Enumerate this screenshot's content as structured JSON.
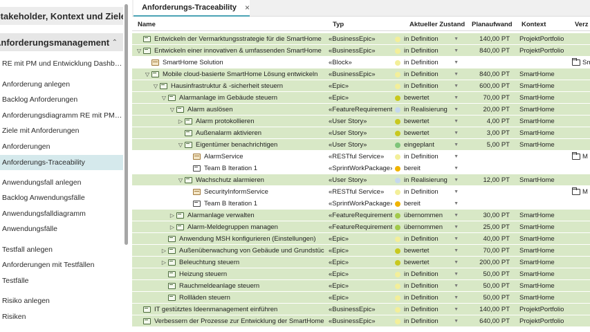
{
  "sidebar": {
    "sections": [
      {
        "label": "Stakeholder, Kontext und Ziele",
        "chevron": "chevron-down-icon"
      },
      {
        "label": "Anforderungsmanagement",
        "chevron": "chevron-up-icon"
      }
    ],
    "items": [
      "RE mit PM und Entwicklung Dashboard",
      "Anforderung anlegen",
      "Backlog Anforderungen",
      "Anforderungsdiagramm RE mit PM u...",
      "Ziele mit Anforderungen",
      "Anforderungen",
      "Anforderungs-Traceability",
      "Anwendungsfall anlegen",
      "Backlog Anwendungsfälle",
      "Anwendungsfalldiagramm",
      "Anwendungsfälle",
      "Testfall anlegen",
      "Anforderungen mit Testfällen",
      "Testfälle",
      "Risiko anlegen",
      "Risiken"
    ],
    "active_item": "Anforderungs-Traceability"
  },
  "tab": {
    "title": "Anforderungs-Traceability",
    "close": "×",
    "icon": "traceability-icon"
  },
  "columns": {
    "name": "Name",
    "type": "Typ",
    "state": "Aktueller Zustand",
    "effort": "Planaufwand",
    "context": "Kontext",
    "dir": "Verz"
  },
  "state_colors": {
    "in Definition": "#f3ef9a",
    "bewertet": "#c8c81e",
    "in Realisierung": "#c5d8ee",
    "eingeplant": "#7fc47a",
    "bereit": "#f0b400",
    "übernommen": "#a2c94a"
  },
  "rows": [
    {
      "indent": 0,
      "arrow": "",
      "icon": "epic",
      "name": "Entwickeln der Vermarktungsstrategie für die SmartHome",
      "type": "«BusinessEpic»",
      "state": "in Definition",
      "effort": "140,00 PT",
      "context": "ProjektPortfolio",
      "dir": "",
      "green": true
    },
    {
      "indent": 0,
      "arrow": "▽",
      "icon": "epic",
      "name": "Entwickeln einer innovativen & umfassenden SmartHome",
      "type": "«BusinessEpic»",
      "state": "in Definition",
      "effort": "840,00 PT",
      "context": "ProjektPortfolio",
      "dir": "",
      "green": true
    },
    {
      "indent": 1,
      "arrow": "",
      "icon": "block",
      "name": "SmartHome Solution",
      "type": "«Block»",
      "state": "in Definition",
      "effort": "",
      "context": "",
      "dir": "Sm",
      "green": false
    },
    {
      "indent": 1,
      "arrow": "▽",
      "icon": "epic",
      "name": "Mobile cloud-basierte SmartHome Lösung entwickeln",
      "type": "«BusinessEpic»",
      "state": "in Definition",
      "effort": "840,00 PT",
      "context": "SmartHome",
      "dir": "",
      "green": true
    },
    {
      "indent": 2,
      "arrow": "▽",
      "icon": "epic",
      "name": "Hausinfrastruktur & -sicherheit steuern",
      "type": "«Epic»",
      "state": "in Definition",
      "effort": "600,00 PT",
      "context": "SmartHome",
      "dir": "",
      "green": true
    },
    {
      "indent": 3,
      "arrow": "▽",
      "icon": "epic",
      "name": "Alarmanlage im Gebäude steuern",
      "type": "«Epic»",
      "state": "bewertet",
      "effort": "70,00 PT",
      "context": "SmartHome",
      "dir": "",
      "green": true
    },
    {
      "indent": 4,
      "arrow": "▽",
      "icon": "epic",
      "name": "Alarm auslösen",
      "type": "«FeatureRequirement»",
      "state": "in Realisierung",
      "effort": "20,00 PT",
      "context": "SmartHome",
      "dir": "",
      "green": true
    },
    {
      "indent": 5,
      "arrow": "▷",
      "icon": "epic",
      "name": "Alarm protokollieren",
      "type": "«User Story»",
      "state": "bewertet",
      "effort": "4,00 PT",
      "context": "SmartHome",
      "dir": "",
      "green": true
    },
    {
      "indent": 5,
      "arrow": "",
      "icon": "epic",
      "name": "Außenalarm aktivieren",
      "type": "«User Story»",
      "state": "bewertet",
      "effort": "3,00 PT",
      "context": "SmartHome",
      "dir": "",
      "green": true
    },
    {
      "indent": 5,
      "arrow": "▽",
      "icon": "epic",
      "name": "Eigentümer benachrichtigen",
      "type": "«User Story»",
      "state": "eingeplant",
      "effort": "5,00 PT",
      "context": "SmartHome",
      "dir": "",
      "green": true
    },
    {
      "indent": 6,
      "arrow": "",
      "icon": "block",
      "name": "AlarmService",
      "type": "«RESTful Service»",
      "state": "in Definition",
      "effort": "",
      "context": "",
      "dir": "M",
      "green": false
    },
    {
      "indent": 6,
      "arrow": "",
      "icon": "pkg",
      "name": "Team B Iteration 1",
      "type": "«SprintWorkPackage»",
      "state": "bereit",
      "effort": "",
      "context": "",
      "dir": "",
      "green": false
    },
    {
      "indent": 5,
      "arrow": "▽",
      "icon": "epic",
      "name": "Wachschutz alarmieren",
      "type": "«User Story»",
      "state": "in Realisierung",
      "effort": "12,00 PT",
      "context": "SmartHome",
      "dir": "",
      "green": true
    },
    {
      "indent": 6,
      "arrow": "",
      "icon": "block",
      "name": "SecurityInformService",
      "type": "«RESTful Service»",
      "state": "in Definition",
      "effort": "",
      "context": "",
      "dir": "M",
      "green": false
    },
    {
      "indent": 6,
      "arrow": "",
      "icon": "pkg",
      "name": "Team B Iteration 1",
      "type": "«SprintWorkPackage»",
      "state": "bereit",
      "effort": "",
      "context": "",
      "dir": "",
      "green": false
    },
    {
      "indent": 4,
      "arrow": "▷",
      "icon": "epic",
      "name": "Alarmanlage verwalten",
      "type": "«FeatureRequirement»",
      "state": "übernommen",
      "effort": "30,00 PT",
      "context": "SmartHome",
      "dir": "",
      "green": true
    },
    {
      "indent": 4,
      "arrow": "▷",
      "icon": "epic",
      "name": "Alarm-Meldegruppen managen",
      "type": "«FeatureRequirement»",
      "state": "übernommen",
      "effort": "25,00 PT",
      "context": "SmartHome",
      "dir": "",
      "green": true
    },
    {
      "indent": 3,
      "arrow": "",
      "icon": "epic",
      "name": "Anwendung MSH konfigurieren (Einstellungen)",
      "type": "«Epic»",
      "state": "in Definition",
      "effort": "40,00 PT",
      "context": "SmartHome",
      "dir": "",
      "green": true
    },
    {
      "indent": 3,
      "arrow": "▷",
      "icon": "epic",
      "name": "Außenüberwachung von Gebäude und Grundstück",
      "type": "«Epic»",
      "state": "bewertet",
      "effort": "70,00 PT",
      "context": "SmartHome",
      "dir": "",
      "green": true
    },
    {
      "indent": 3,
      "arrow": "▷",
      "icon": "epic",
      "name": "Beleuchtung steuern",
      "type": "«Epic»",
      "state": "bewertet",
      "effort": "200,00 PT",
      "context": "SmartHome",
      "dir": "",
      "green": true
    },
    {
      "indent": 3,
      "arrow": "",
      "icon": "epic",
      "name": "Heizung steuern",
      "type": "«Epic»",
      "state": "in Definition",
      "effort": "50,00 PT",
      "context": "SmartHome",
      "dir": "",
      "green": true
    },
    {
      "indent": 3,
      "arrow": "",
      "icon": "epic",
      "name": "Rauchmeldeanlage steuern",
      "type": "«Epic»",
      "state": "in Definition",
      "effort": "50,00 PT",
      "context": "SmartHome",
      "dir": "",
      "green": true
    },
    {
      "indent": 3,
      "arrow": "",
      "icon": "epic",
      "name": "Rollläden steuern",
      "type": "«Epic»",
      "state": "in Definition",
      "effort": "50,00 PT",
      "context": "SmartHome",
      "dir": "",
      "green": true
    },
    {
      "indent": 0,
      "arrow": "",
      "icon": "epic",
      "name": "IT gestütztes Ideenmanagement einführen",
      "type": "«BusinessEpic»",
      "state": "in Definition",
      "effort": "140,00 PT",
      "context": "ProjektPortfolio",
      "dir": "",
      "green": true
    },
    {
      "indent": 0,
      "arrow": "",
      "icon": "epic",
      "name": "Verbessern der Prozesse zur Entwicklung der SmartHome",
      "type": "«BusinessEpic»",
      "state": "in Definition",
      "effort": "640,00 PT",
      "context": "ProjektPortfolio",
      "dir": "",
      "green": true
    }
  ]
}
